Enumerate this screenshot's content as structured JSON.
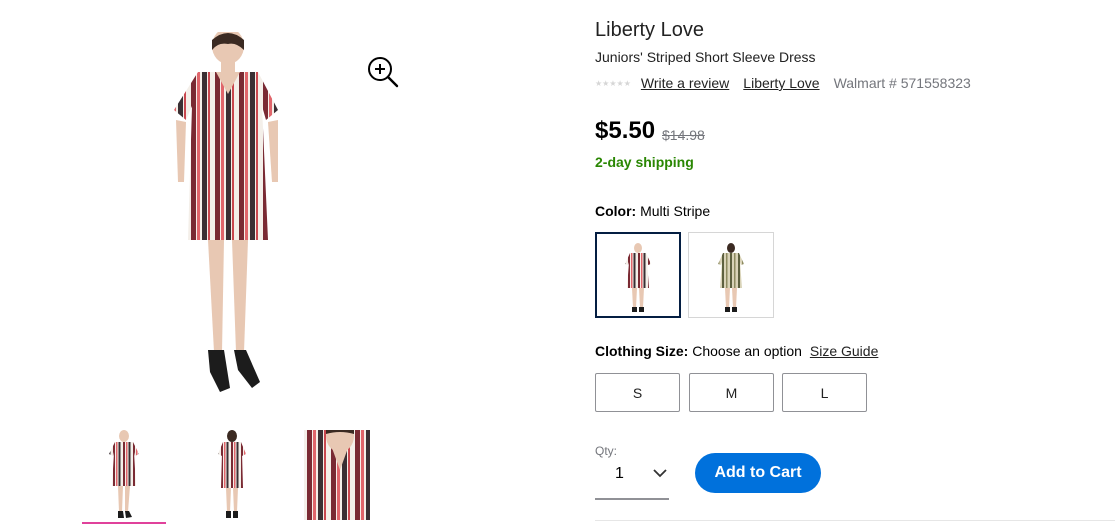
{
  "product": {
    "brand": "Liberty Love",
    "name": "Juniors' Striped Short Sleeve Dress",
    "write_review_label": "Write a review",
    "brand_link_label": "Liberty Love",
    "walmart_number": "Walmart # 571558323",
    "rating_stars": "★★★★★",
    "price": "$5.50",
    "was_price": "$14.98",
    "shipping": "2-day shipping"
  },
  "color": {
    "label": "Color:",
    "selected": "Multi Stripe",
    "swatches": [
      {
        "name": "Multi Stripe",
        "selected": true
      },
      {
        "name": "Olive Stripe",
        "selected": false
      }
    ]
  },
  "size": {
    "label": "Clothing Size:",
    "placeholder": "Choose an option",
    "guide_label": "Size Guide",
    "options": [
      "S",
      "M",
      "L"
    ]
  },
  "quantity": {
    "label": "Qty:",
    "value": "1"
  },
  "cart": {
    "add_label": "Add to Cart"
  },
  "gallery": {
    "zoom_icon": "zoom-in-icon",
    "thumbnails": [
      "front-view",
      "back-view",
      "detail-view"
    ],
    "selected_thumbnail": 0
  },
  "colors": {
    "accent_blue": "#0071dc",
    "shipping_green": "#2a8703",
    "thumbnail_highlight": "#e0419b",
    "selected_border": "#041e42"
  }
}
